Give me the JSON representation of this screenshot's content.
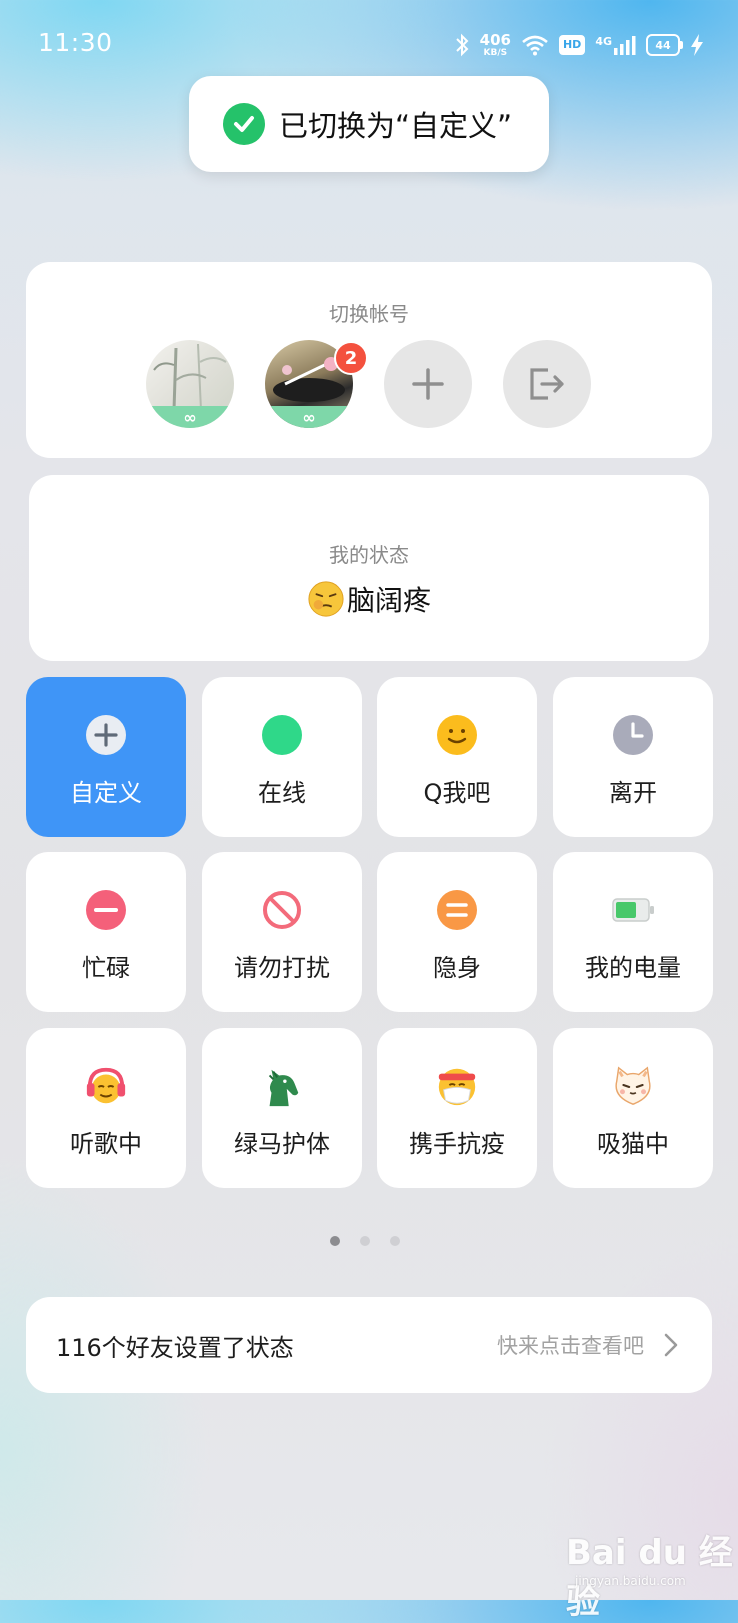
{
  "status_bar": {
    "time": "11:30",
    "net_speed": "406",
    "net_unit": "KB/S",
    "hd": "HD",
    "network": "4G",
    "battery": "44"
  },
  "toast": {
    "text": "已切换为“自定义”",
    "icon": "check-circle-icon"
  },
  "accounts": {
    "title": "切换帐号",
    "avatars": [
      {
        "name": "bamboo-painting-avatar",
        "band": "∞"
      },
      {
        "name": "ink-photo-avatar",
        "band": "∞",
        "badge": "2"
      }
    ],
    "add_icon": "plus-icon",
    "logout_icon": "logout-icon"
  },
  "mood": {
    "title": "我的状态",
    "value": "脑阔疼",
    "emoji": "headache-emoji"
  },
  "tiles": [
    {
      "label": "自定义",
      "icon": "plus-circle-icon",
      "active": true
    },
    {
      "label": "在线",
      "icon": "green-dot-icon"
    },
    {
      "label": "Q我吧",
      "icon": "smile-icon"
    },
    {
      "label": "离开",
      "icon": "clock-icon"
    },
    {
      "label": "忙碌",
      "icon": "minus-circle-icon"
    },
    {
      "label": "请勿打扰",
      "icon": "no-entry-icon"
    },
    {
      "label": "隐身",
      "icon": "equals-circle-icon"
    },
    {
      "label": "我的电量",
      "icon": "battery-icon"
    },
    {
      "label": "听歌中",
      "icon": "headphones-emoji-icon"
    },
    {
      "label": "绿马护体",
      "icon": "green-horse-icon"
    },
    {
      "label": "携手抗疫",
      "icon": "mask-emoji-icon"
    },
    {
      "label": "吸猫中",
      "icon": "cat-icon"
    }
  ],
  "pager": {
    "count": 3,
    "current": 0
  },
  "friends": {
    "text": "116个好友设置了状态",
    "hint": "快来点击查看吧"
  },
  "watermark": {
    "text": "Bai du 经验",
    "sub": "jingyan.baidu.com"
  },
  "colors": {
    "accent": "#3f95f7",
    "toast_check": "#25c26a",
    "badge": "#f4513e"
  }
}
